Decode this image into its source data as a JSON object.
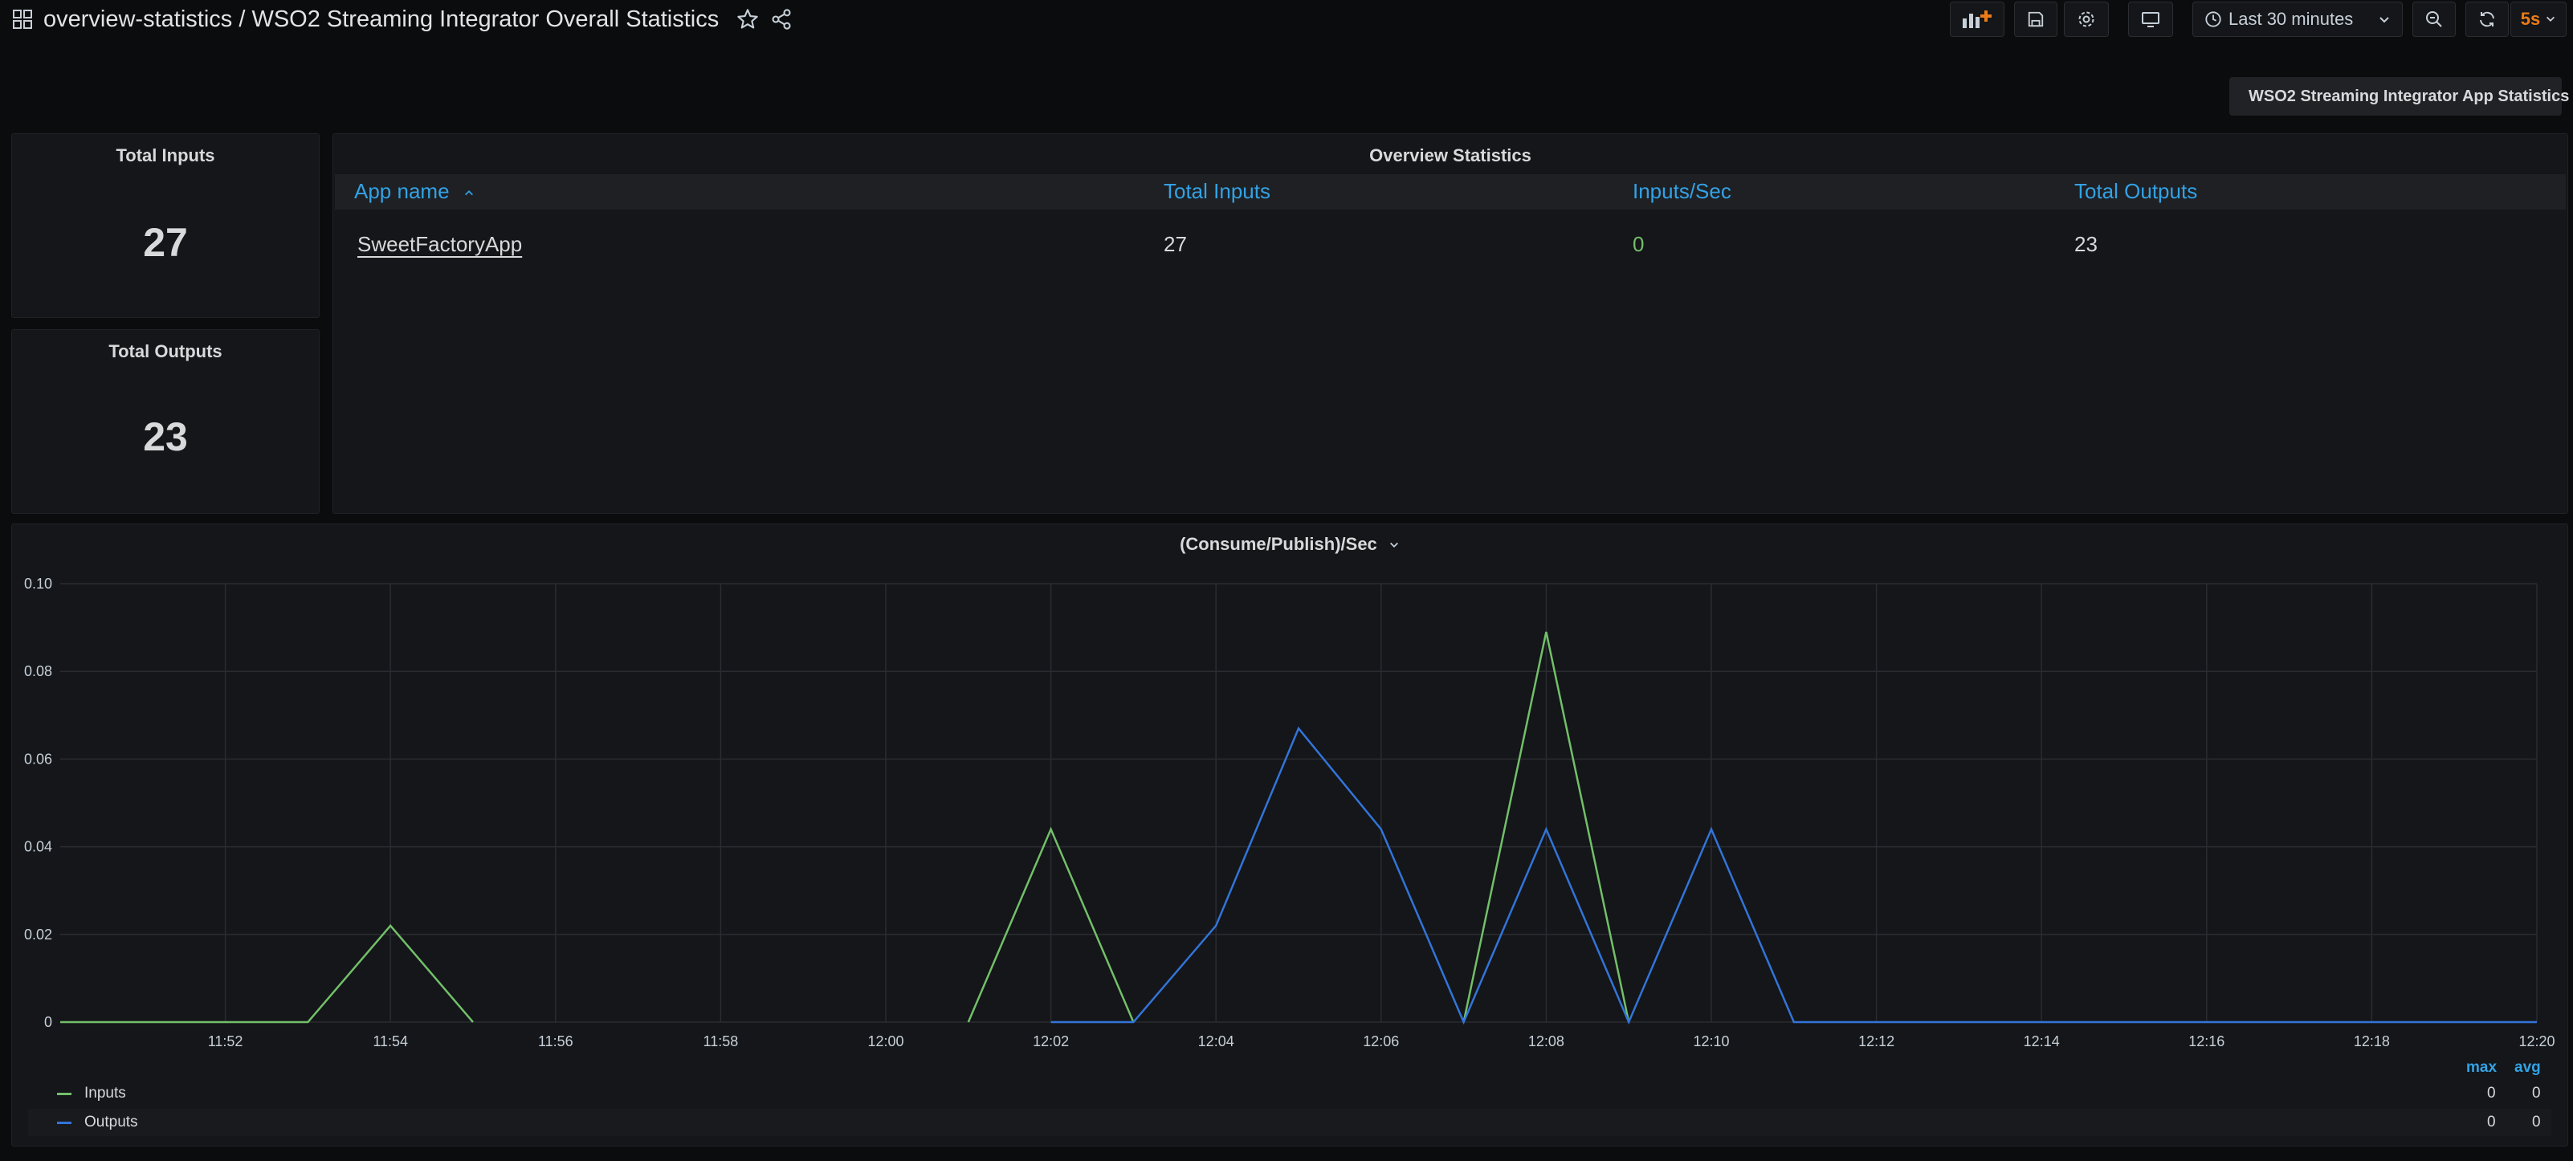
{
  "header": {
    "title": "overview-statistics / WSO2 Streaming Integrator Overall Statistics",
    "time_range": "Last 30 minutes",
    "refresh_interval": "5s",
    "icons": [
      "apps-icon",
      "star-icon",
      "share-icon",
      "add-panel-icon",
      "save-icon",
      "gear-icon",
      "tv-icon",
      "clock-icon",
      "chevron-down-icon",
      "zoom-out-icon",
      "refresh-icon"
    ]
  },
  "link_button": {
    "label": "WSO2 Streaming Integrator App Statistics"
  },
  "stats": {
    "total_inputs": {
      "title": "Total Inputs",
      "value": "27"
    },
    "total_outputs": {
      "title": "Total Outputs",
      "value": "23"
    }
  },
  "table": {
    "title": "Overview Statistics",
    "columns": [
      "App name",
      "Total Inputs",
      "Inputs/Sec",
      "Total Outputs"
    ],
    "rows": [
      {
        "app_name": "SweetFactoryApp",
        "total_inputs": "27",
        "inputs_per_sec": "0",
        "total_outputs": "23"
      }
    ]
  },
  "chart_data": {
    "type": "line",
    "title": "(Consume/Publish)/Sec",
    "xlabel": "",
    "ylabel": "",
    "x_ticks": [
      "11:52",
      "11:54",
      "11:56",
      "11:58",
      "12:00",
      "12:02",
      "12:04",
      "12:06",
      "12:08",
      "12:10",
      "12:12",
      "12:14",
      "12:16",
      "12:18",
      "12:20"
    ],
    "y_ticks": [
      "0",
      "0.02",
      "0.04",
      "0.06",
      "0.08",
      "0.10"
    ],
    "ylim": [
      0,
      0.1
    ],
    "grid": true,
    "legend_position": "bottom",
    "legend_columns": [
      "max",
      "avg"
    ],
    "series": [
      {
        "name": "Inputs",
        "color": "#73bf69",
        "x": [
          "11:50",
          "11:51",
          "11:52",
          "11:53",
          "11:54",
          "11:55"
        ],
        "values": [
          0,
          0,
          0,
          0,
          0.022,
          0
        ],
        "x2": [
          "12:01",
          "12:02",
          "12:03"
        ],
        "values2": [
          0,
          0.044,
          0
        ],
        "x3": [
          "12:07",
          "12:08",
          "12:09"
        ],
        "values3": [
          0,
          0.089,
          0
        ],
        "max": "0",
        "avg": "0"
      },
      {
        "name": "Outputs",
        "color": "#3274d9",
        "x": [
          "12:02",
          "12:03",
          "12:04",
          "12:05",
          "12:06",
          "12:07",
          "12:08",
          "12:09",
          "12:10",
          "12:11",
          "12:12",
          "12:13",
          "12:14",
          "12:15",
          "12:16",
          "12:17",
          "12:18",
          "12:19",
          "12:20"
        ],
        "values": [
          0,
          0,
          0.022,
          0.067,
          0.044,
          0,
          0.044,
          0,
          0.044,
          0,
          0,
          0,
          0,
          0,
          0,
          0,
          0,
          0,
          0
        ],
        "max": "0",
        "avg": "0"
      }
    ]
  }
}
